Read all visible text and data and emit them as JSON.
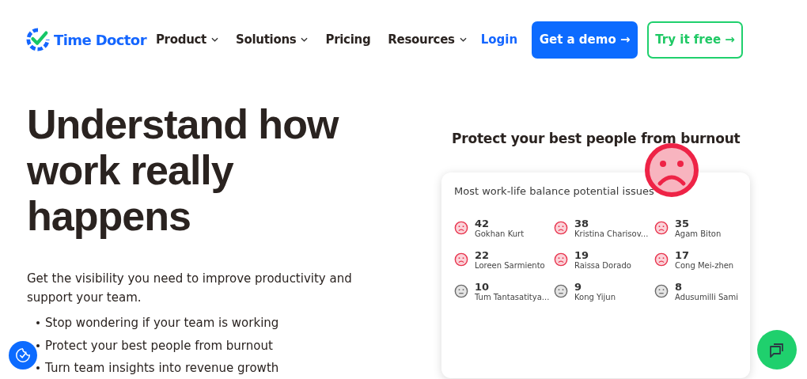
{
  "nav": {
    "brand": "Time Doctor",
    "items": [
      {
        "label": "Product",
        "dropdown": true
      },
      {
        "label": "Solutions",
        "dropdown": true
      },
      {
        "label": "Pricing",
        "dropdown": false
      },
      {
        "label": "Resources",
        "dropdown": true
      }
    ],
    "login": "Login",
    "demo_button": "Get a demo →",
    "trial_button": "Try it free →"
  },
  "hero": {
    "heading": "Understand how work really happens",
    "intro": "Get the visibility you need to improve productivity and support your team.",
    "bullets": [
      "Stop wondering if your team is working",
      "Protect your best people from burnout",
      "Turn team insights into revenue growth"
    ]
  },
  "panel": {
    "title": "Protect your best people from burnout",
    "card_title": "Most work-life balance potential issues",
    "people": [
      {
        "count": "42",
        "name": "Gokhan Kurt",
        "kind": "sad"
      },
      {
        "count": "38",
        "name": "Kristina Charisov...",
        "kind": "sad"
      },
      {
        "count": "35",
        "name": "Agam Biton",
        "kind": "sad"
      },
      {
        "count": "22",
        "name": "Loreen Sarmiento",
        "kind": "sad"
      },
      {
        "count": "19",
        "name": "Raissa Dorado",
        "kind": "sad"
      },
      {
        "count": "17",
        "name": "Cong Mei-zhen",
        "kind": "sad"
      },
      {
        "count": "10",
        "name": "Tum Tantasatitya...",
        "kind": "neutral"
      },
      {
        "count": "9",
        "name": "Kong Yijun",
        "kind": "neutral"
      },
      {
        "count": "8",
        "name": "Adusumilli Sami",
        "kind": "neutral"
      }
    ]
  }
}
